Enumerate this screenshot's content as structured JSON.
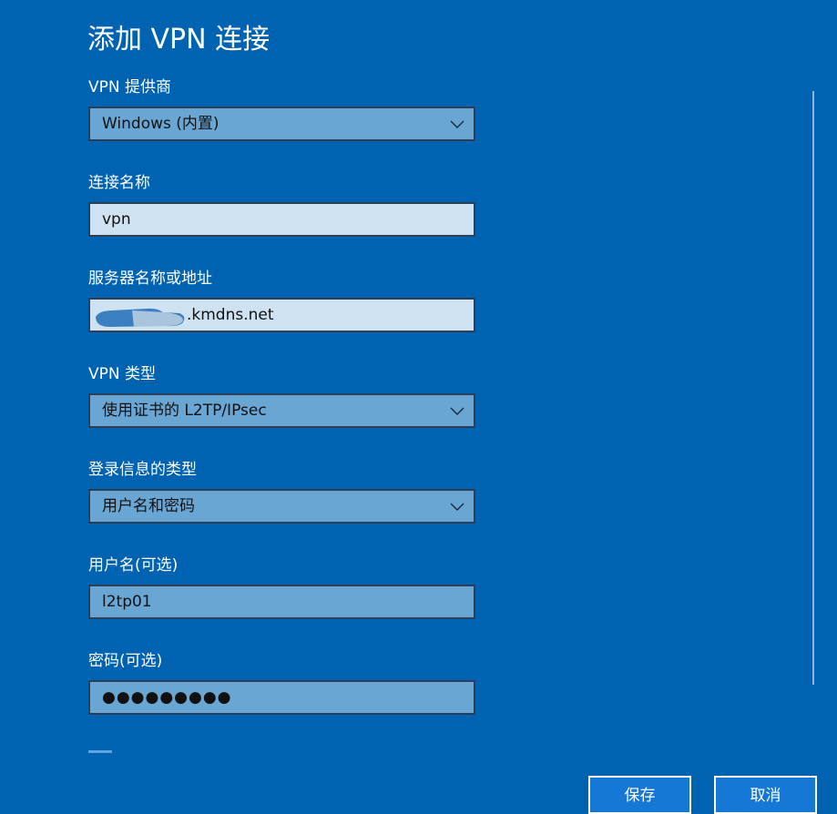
{
  "window": {
    "title": "添加 VPN 连接"
  },
  "form": {
    "provider": {
      "label": "VPN 提供商",
      "value": "Windows (内置)"
    },
    "connection_name": {
      "label": "连接名称",
      "value": "vpn"
    },
    "server": {
      "label": "服务器名称或地址",
      "value_visible_suffix": ".kmdns.net"
    },
    "vpn_type": {
      "label": "VPN 类型",
      "value": "使用证书的 L2TP/IPsec"
    },
    "signin_type": {
      "label": "登录信息的类型",
      "value": "用户名和密码"
    },
    "username": {
      "label": "用户名(可选)",
      "value": "l2tp01"
    },
    "password": {
      "label": "密码(可选)",
      "value": "●●●●●●●●●"
    }
  },
  "buttons": {
    "save_label": "保存",
    "cancel_label": "取消"
  },
  "colors": {
    "background": "#0063b1",
    "select_fill": "#6aa6d4",
    "input_light_fill": "#cfe2f1",
    "button_fill": "#1478d4"
  },
  "icons": {
    "dropdown": "chevron-down-icon"
  }
}
